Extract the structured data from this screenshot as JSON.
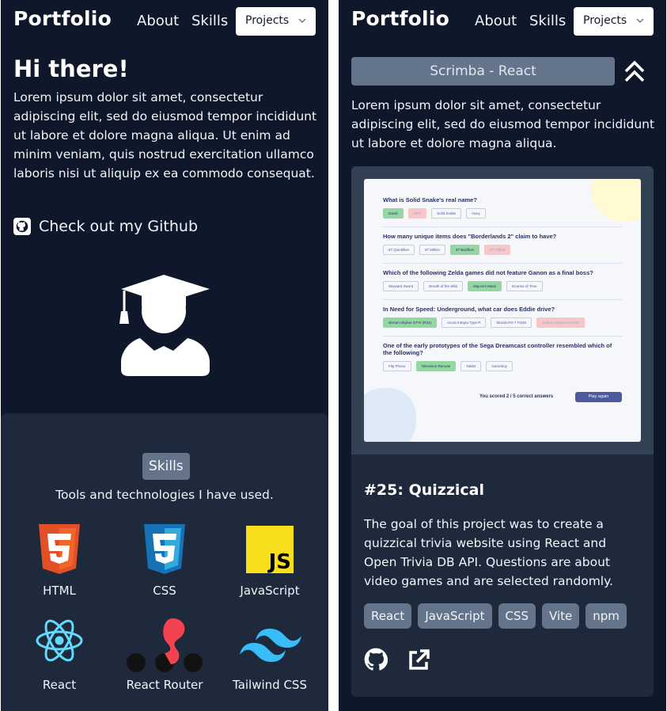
{
  "left": {
    "nav": {
      "brand": "Portfolio",
      "about": "About",
      "skills": "Skills",
      "projects": "Projects"
    },
    "hero": {
      "title": "Hi there!",
      "text": "Lorem ipsum dolor sit amet, consectetur adipiscing elit, sed do eiusmod tempor incididunt ut labore et dolore magna aliqua. Ut enim ad minim veniam, quis nostrud exercitation ullamco laboris nisi ut aliquip ex ea commodo consequat.",
      "github_link": "Check out my Github",
      "icons": [
        "github-icon",
        "graduate-icon"
      ]
    },
    "skills": {
      "badge": "Skills",
      "subtitle": "Tools and technologies I have used.",
      "items": [
        {
          "name": "HTML",
          "icon": "html5-icon"
        },
        {
          "name": "CSS",
          "icon": "css3-icon"
        },
        {
          "name": "JavaScript",
          "icon": "javascript-icon"
        },
        {
          "name": "React",
          "icon": "react-icon"
        },
        {
          "name": "React Router",
          "icon": "react-router-icon"
        },
        {
          "name": "Tailwind CSS",
          "icon": "tailwind-icon"
        }
      ]
    }
  },
  "right": {
    "nav": {
      "brand": "Portfolio",
      "about": "About",
      "skills": "Skills",
      "projects": "Projects"
    },
    "section_title": "Scrimba - React",
    "intro": "Lorem ipsum dolor sit amet, consectetur adipiscing elit, sed do eiusmod tempor incididunt ut labore et dolore magna aliqua.",
    "project": {
      "name": "#25: Quizzical",
      "description": "The goal of this project was to create a quizzical trivia website using React and Open Trivia DB API. Questions are about video games and are selected randomly.",
      "tags": [
        "React",
        "JavaScript",
        "CSS",
        "Vite",
        "npm"
      ],
      "screenshot": {
        "questions": [
          {
            "q": "What is Solid Snake's real name?",
            "answers": [
              "David",
              "John",
              "Solid Snake",
              "Huey"
            ],
            "states": [
              "ok",
              "bad",
              "",
              ""
            ]
          },
          {
            "q": "How many unique items does \"Borderlands 2\" claim to have?",
            "answers": [
              "87 Quintillion",
              "87 Million",
              "87 Bazillion",
              "87 Trillion"
            ],
            "states": [
              "",
              "",
              "ok",
              "bad"
            ]
          },
          {
            "q": "Which of the following Zelda games did not feature Ganon as a final boss?",
            "answers": [
              "Skyward Sword",
              "Breath of the Wild",
              "Majora's Mask",
              "Ocarina of Time"
            ],
            "states": [
              "",
              "",
              "ok",
              ""
            ]
          },
          {
            "q": "In Need for Speed: Underground, what car does Eddie drive?",
            "answers": [
              "Nissan Skyline GT-R (R34)",
              "Acura Integra Type R",
              "Mazda RX-7 FD3S",
              "Subaru Impreza 2.5 RS"
            ],
            "states": [
              "ok",
              "",
              "",
              "bad"
            ]
          },
          {
            "q": "One of the early prototypes of the Sega Dreamcast controller resembled which of the following?",
            "answers": [
              "Flip Phone",
              "Television Remote",
              "Tablet",
              "Gameboy"
            ],
            "states": [
              "",
              "ok",
              "",
              ""
            ]
          }
        ],
        "score": "You scored 2 / 5 correct answers",
        "play_again": "Play again"
      }
    }
  }
}
